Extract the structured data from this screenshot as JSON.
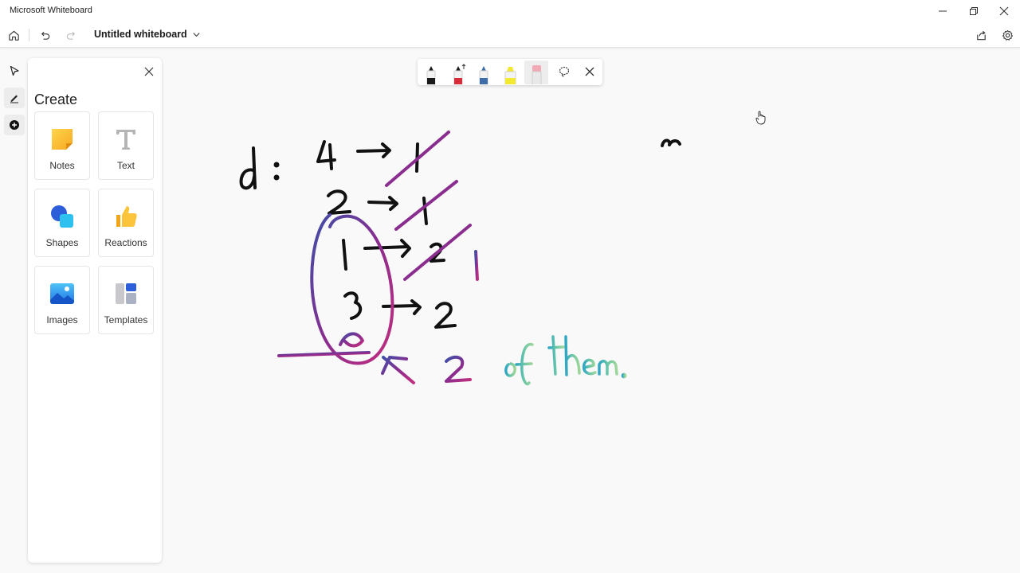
{
  "app": {
    "window_title": "Microsoft Whiteboard",
    "board_title": "Untitled whiteboard"
  },
  "window_controls": {
    "minimize_icon": "minimize-icon",
    "restore_icon": "restore-icon",
    "close_icon": "close-icon"
  },
  "command_bar": {
    "home_icon": "home-icon",
    "undo_icon": "undo-icon",
    "redo_icon": "redo-icon",
    "share_icon": "share-icon",
    "settings_icon": "gear-icon"
  },
  "rail": {
    "items": [
      {
        "icon": "select-arrow-icon"
      },
      {
        "icon": "pen-icon"
      },
      {
        "icon": "add-icon"
      }
    ]
  },
  "create_panel": {
    "title": "Create",
    "tiles": [
      {
        "label": "Notes",
        "icon": "sticky-note-icon"
      },
      {
        "label": "Text",
        "icon": "text-icon"
      },
      {
        "label": "Shapes",
        "icon": "shapes-icon"
      },
      {
        "label": "Reactions",
        "icon": "thumbs-up-icon"
      },
      {
        "label": "Images",
        "icon": "image-icon"
      },
      {
        "label": "Templates",
        "icon": "templates-icon"
      }
    ]
  },
  "pen_toolbar": {
    "pens": [
      {
        "name": "black-pen",
        "color": "#1a1a1a"
      },
      {
        "name": "red-pen",
        "color": "#d62d3a"
      },
      {
        "name": "blue-pen",
        "color": "#3d6ea8"
      },
      {
        "name": "yellow-highlighter",
        "color": "#f3e832"
      },
      {
        "name": "eraser",
        "color": "#f1a9b5"
      }
    ],
    "lasso_icon": "lasso-icon",
    "close_icon": "close-icon"
  },
  "canvas": {
    "ink_colors": {
      "black": "#111111",
      "purple": "#7a2c8c",
      "magenta": "#b42c83",
      "blue": "#3d5fa6",
      "teal": "#3fb5b0",
      "green": "#7ecb98"
    },
    "handwriting": {
      "label": "d :",
      "rows": [
        {
          "from": "4",
          "to": "1"
        },
        {
          "from": "2",
          "to": "1"
        },
        {
          "from": "1",
          "to": "2"
        },
        {
          "from": "3",
          "to": "2"
        }
      ],
      "side_mark": "1",
      "count": "2",
      "note": "of them."
    }
  }
}
